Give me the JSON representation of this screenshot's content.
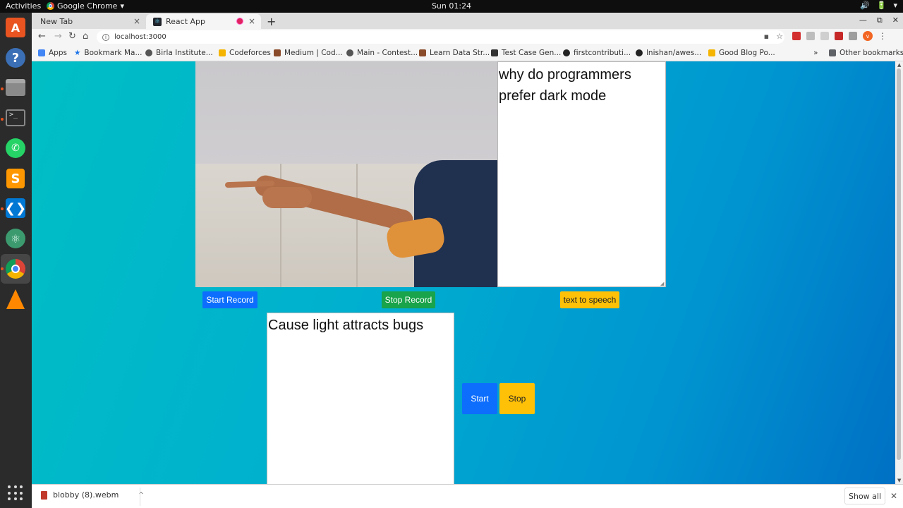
{
  "system": {
    "activities": "Activities",
    "app_name": "Google Chrome",
    "app_caret": "▾",
    "clock": "Sun 01:24",
    "tray": {
      "volume": "🔊",
      "power": "🔋",
      "menu": "▾"
    }
  },
  "dock": {
    "items": [
      "ubuntu-software",
      "help",
      "files",
      "terminal",
      "whatsapp",
      "sublime-text",
      "vscode",
      "atom",
      "google-chrome",
      "vlc",
      "show-applications"
    ]
  },
  "browser": {
    "tabs": [
      {
        "title": "New Tab",
        "close": "×"
      },
      {
        "title": "React App",
        "close": "×"
      }
    ],
    "new_tab": "+",
    "window_controls": {
      "minimize": "—",
      "maximize": "⧉",
      "close": "✕"
    },
    "nav": {
      "back": "←",
      "forward": "→",
      "reload": "↻",
      "home": "⌂"
    },
    "url": "localhost:3000",
    "info_icon": "i",
    "omnibox_icons": {
      "camera": "▪",
      "star": "☆"
    },
    "profile_initial": "v",
    "menu_icon": "⋮",
    "bookmarks": [
      {
        "label": "Apps",
        "color": "#4285f4"
      },
      {
        "label": "Bookmark Ma...",
        "color": "#1a73e8"
      },
      {
        "label": "Birla Institute...",
        "color": "#555555"
      },
      {
        "label": "Codeforces",
        "color": "#f4b400"
      },
      {
        "label": "Medium | Cod...",
        "color": "#8a4b2a"
      },
      {
        "label": "Main - Contest...",
        "color": "#555555"
      },
      {
        "label": "Learn Data Str...",
        "color": "#8a4b2a"
      },
      {
        "label": "Test Case Gen...",
        "color": "#333333"
      },
      {
        "label": "firstcontributi...",
        "color": "#222222"
      },
      {
        "label": "lnishan/awes...",
        "color": "#222222"
      },
      {
        "label": "Good Blog Po...",
        "color": "#f4b400"
      }
    ],
    "bookmarks_overflow": "»",
    "other_bookmarks": "Other bookmarks"
  },
  "app": {
    "question_text": "why do programmers prefer dark mode",
    "answer_text": "Cause light attracts bugs",
    "buttons": {
      "start_record": "Start Record",
      "stop_record": "Stop Record",
      "text_to_speech": "text to speech",
      "start": "Start",
      "stop": "Stop"
    },
    "colors": {
      "primary": "#0d6efd",
      "success": "#19a34a",
      "warning": "#ffc107",
      "background_start": "#00bfc4",
      "background_end": "#0070c4"
    }
  },
  "downloads": {
    "file_name": "blobby (8).webm",
    "caret": "^",
    "show_all": "Show all",
    "close": "✕"
  }
}
